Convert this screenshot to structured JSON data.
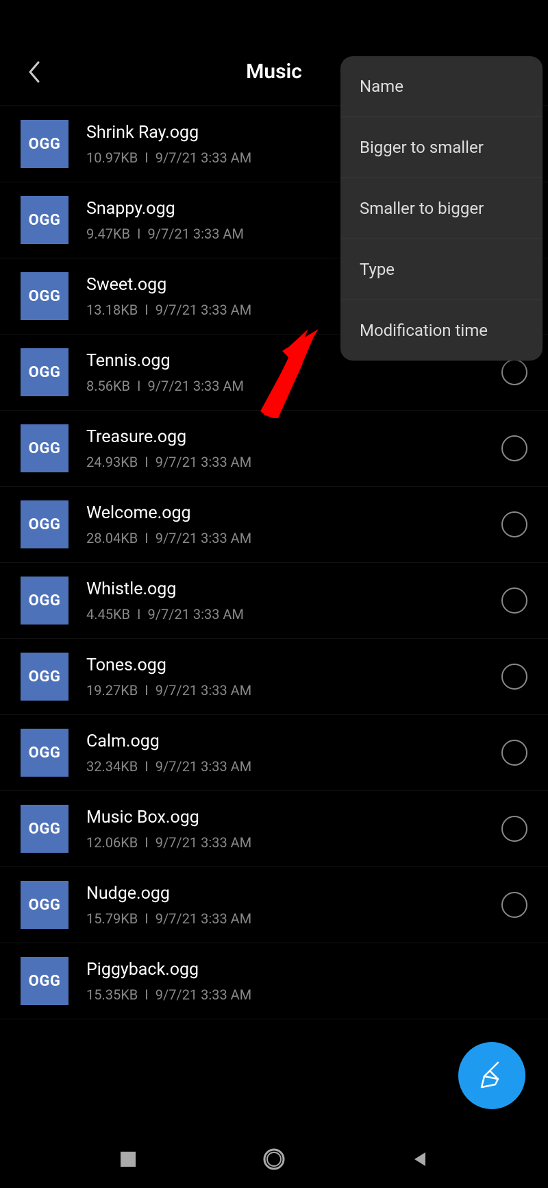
{
  "header": {
    "title": "Music"
  },
  "file_type_label": "OGG",
  "popup": {
    "items": [
      {
        "label": "Name"
      },
      {
        "label": "Bigger to smaller"
      },
      {
        "label": "Smaller to bigger"
      },
      {
        "label": "Type"
      },
      {
        "label": "Modification time"
      }
    ]
  },
  "files": [
    {
      "name": "Shrink Ray.ogg",
      "size": "10.97KB",
      "date": "9/7/21 3:33 AM",
      "radio": false
    },
    {
      "name": "Snappy.ogg",
      "size": "9.47KB",
      "date": "9/7/21 3:33 AM",
      "radio": false
    },
    {
      "name": "Sweet.ogg",
      "size": "13.18KB",
      "date": "9/7/21 3:33 AM",
      "radio": false
    },
    {
      "name": "Tennis.ogg",
      "size": "8.56KB",
      "date": "9/7/21 3:33 AM",
      "radio": true
    },
    {
      "name": "Treasure.ogg",
      "size": "24.93KB",
      "date": "9/7/21 3:33 AM",
      "radio": true
    },
    {
      "name": "Welcome.ogg",
      "size": "28.04KB",
      "date": "9/7/21 3:33 AM",
      "radio": true
    },
    {
      "name": "Whistle.ogg",
      "size": "4.45KB",
      "date": "9/7/21 3:33 AM",
      "radio": true
    },
    {
      "name": "Tones.ogg",
      "size": "19.27KB",
      "date": "9/7/21 3:33 AM",
      "radio": true
    },
    {
      "name": "Calm.ogg",
      "size": "32.34KB",
      "date": "9/7/21 3:33 AM",
      "radio": true
    },
    {
      "name": "Music Box.ogg",
      "size": "12.06KB",
      "date": "9/7/21 3:33 AM",
      "radio": true
    },
    {
      "name": "Nudge.ogg",
      "size": "15.79KB",
      "date": "9/7/21 3:33 AM",
      "radio": true
    },
    {
      "name": "Piggyback.ogg",
      "size": "15.35KB",
      "date": "9/7/21 3:33 AM",
      "radio": false
    }
  ]
}
